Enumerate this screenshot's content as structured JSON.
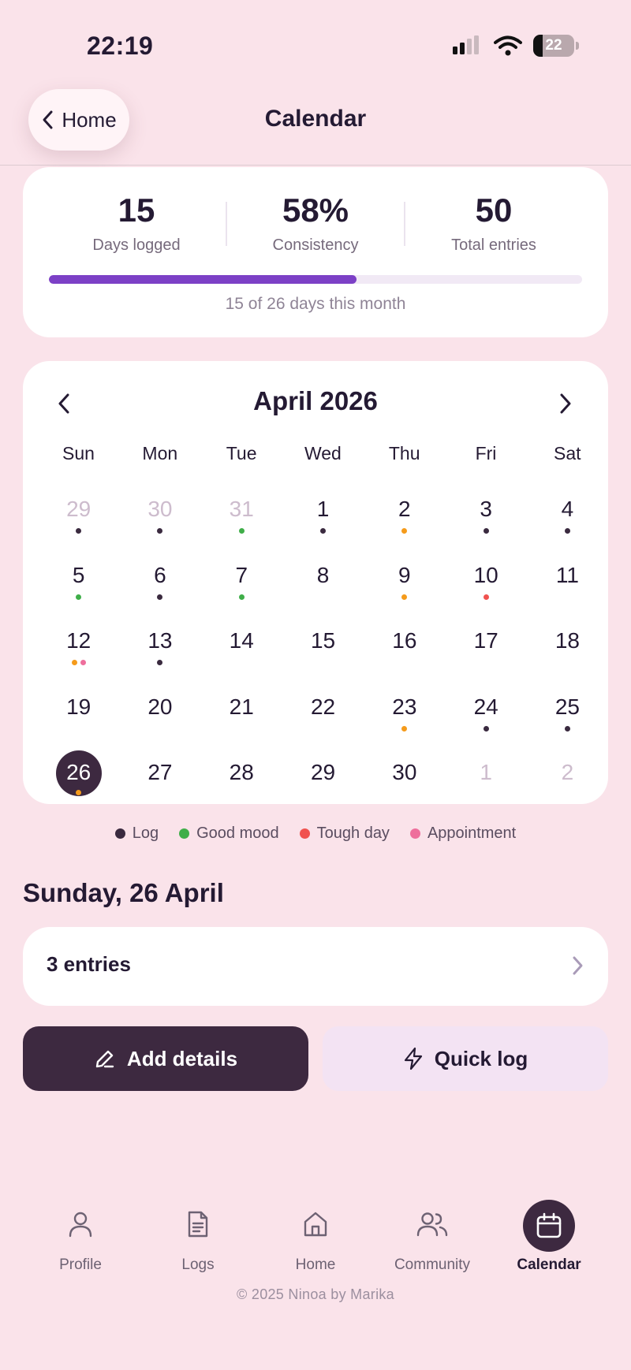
{
  "status_bar": {
    "time": "22:19",
    "battery": "22"
  },
  "header": {
    "back_label": "Home",
    "title": "Calendar"
  },
  "stats": {
    "items": [
      {
        "value": "15",
        "label": "Days logged"
      },
      {
        "value": "58%",
        "label": "Consistency"
      },
      {
        "value": "50",
        "label": "Total entries"
      }
    ],
    "progress_fraction": 0.577,
    "progress_caption": "15 of 26 days this month"
  },
  "calendar": {
    "month_title": "April 2026",
    "weekdays": [
      "Sun",
      "Mon",
      "Tue",
      "Wed",
      "Thu",
      "Fri",
      "Sat"
    ],
    "weeks": [
      [
        {
          "day": "29",
          "muted": true,
          "dots": [
            "log"
          ]
        },
        {
          "day": "30",
          "muted": true,
          "dots": [
            "log"
          ]
        },
        {
          "day": "31",
          "muted": true,
          "dots": [
            "good"
          ]
        },
        {
          "day": "1",
          "dots": [
            "log"
          ]
        },
        {
          "day": "2",
          "dots": [
            "orange"
          ]
        },
        {
          "day": "3",
          "dots": [
            "log"
          ]
        },
        {
          "day": "4",
          "dots": [
            "log"
          ]
        }
      ],
      [
        {
          "day": "5",
          "dots": [
            "good"
          ]
        },
        {
          "day": "6",
          "dots": [
            "log"
          ]
        },
        {
          "day": "7",
          "dots": [
            "good"
          ]
        },
        {
          "day": "8",
          "dots": []
        },
        {
          "day": "9",
          "dots": [
            "orange"
          ]
        },
        {
          "day": "10",
          "dots": [
            "tough"
          ]
        },
        {
          "day": "11",
          "dots": []
        }
      ],
      [
        {
          "day": "12",
          "dots": [
            "orange",
            "appointment"
          ]
        },
        {
          "day": "13",
          "dots": [
            "log"
          ]
        },
        {
          "day": "14",
          "dots": []
        },
        {
          "day": "15",
          "dots": []
        },
        {
          "day": "16",
          "dots": []
        },
        {
          "day": "17",
          "dots": []
        },
        {
          "day": "18",
          "dots": []
        }
      ],
      [
        {
          "day": "19",
          "dots": []
        },
        {
          "day": "20",
          "dots": []
        },
        {
          "day": "21",
          "dots": []
        },
        {
          "day": "22",
          "dots": []
        },
        {
          "day": "23",
          "dots": [
            "orange"
          ]
        },
        {
          "day": "24",
          "dots": [
            "log"
          ]
        },
        {
          "day": "25",
          "dots": [
            "log"
          ]
        }
      ],
      [
        {
          "day": "26",
          "selected": true,
          "dots": [
            "orange"
          ]
        },
        {
          "day": "27",
          "dots": []
        },
        {
          "day": "28",
          "dots": []
        },
        {
          "day": "29",
          "dots": []
        },
        {
          "day": "30",
          "dots": []
        },
        {
          "day": "1",
          "muted": true,
          "dots": []
        },
        {
          "day": "2",
          "muted": true,
          "dots": []
        }
      ]
    ]
  },
  "dot_colors": {
    "log": "#3a2a3f",
    "good": "#3fae49",
    "tough": "#f0524f",
    "appointment": "#ee6f9c",
    "orange": "#f59b1b"
  },
  "legend": [
    {
      "key": "log",
      "label": "Log"
    },
    {
      "key": "good",
      "label": "Good mood"
    },
    {
      "key": "tough",
      "label": "Tough day"
    },
    {
      "key": "appointment",
      "label": "Appointment"
    }
  ],
  "selected_date": {
    "heading": "Sunday, 26 April",
    "entries_label": "3 entries"
  },
  "actions": {
    "add_details": "Add details",
    "quick_log": "Quick log"
  },
  "tabs": [
    {
      "id": "profile",
      "label": "Profile",
      "icon": "user-icon"
    },
    {
      "id": "logs",
      "label": "Logs",
      "icon": "document-icon"
    },
    {
      "id": "home",
      "label": "Home",
      "icon": "house-icon"
    },
    {
      "id": "community",
      "label": "Community",
      "icon": "users-icon"
    },
    {
      "id": "calendar",
      "label": "Calendar",
      "icon": "calendar-icon",
      "active": true
    }
  ],
  "footer": "© 2025 Ninoa by Marika",
  "colors": {
    "accent": "#7c40c6",
    "dark": "#3d2940",
    "background": "#fae3ea"
  }
}
